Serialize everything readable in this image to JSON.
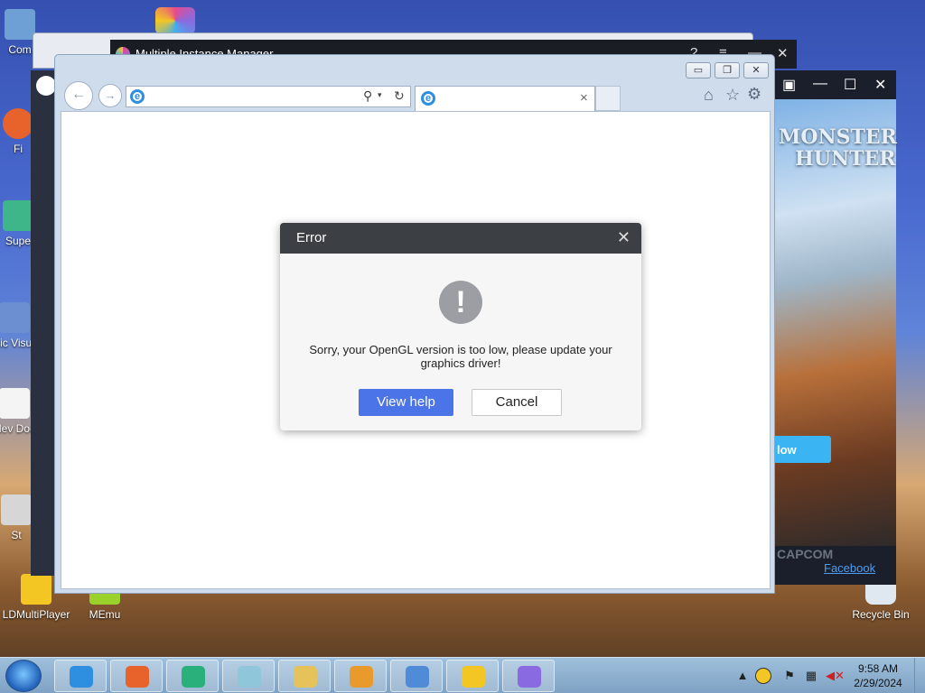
{
  "desktop": {
    "icons": [
      {
        "label": "Com",
        "icon": "computer-icon"
      },
      {
        "label": "Fi",
        "icon": "firefox-icon"
      },
      {
        "label": "Supe",
        "icon": "app-icon"
      },
      {
        "label": "Mic Visua",
        "icon": "app-icon"
      },
      {
        "label": "Nev Doc",
        "icon": "document-icon"
      },
      {
        "label": "St",
        "icon": "app-icon"
      },
      {
        "label": "LDMultiPlayer",
        "icon": "ldmultiplayer-icon"
      },
      {
        "label": "MEmu",
        "icon": "memu-icon"
      },
      {
        "label": "Recycle Bin",
        "icon": "recycle-bin-icon"
      }
    ]
  },
  "mim_window": {
    "title": "Multiple Instance Manager",
    "help": "?",
    "menu": "≡",
    "minimize": "—",
    "close": "✕"
  },
  "game_window": {
    "minimize": "—",
    "maximize": "☐",
    "close": "✕",
    "logo_line1": "MONSTER",
    "logo_line2": "HUNTER",
    "follow_label": "low",
    "capcom": "CAPCOM",
    "facebook": "Facebook"
  },
  "browser": {
    "btn_minimize": "▭",
    "btn_restore": "❐",
    "btn_close": "✕",
    "back": "←",
    "forward": "→",
    "address_value": "",
    "search_glyph": "⚲",
    "refresh_glyph": "↻",
    "tab_title": "",
    "tab_close": "×",
    "home": "⌂",
    "favorites": "☆",
    "settings": "⚙"
  },
  "dialog": {
    "title": "Error",
    "close": "✕",
    "icon_glyph": "!",
    "message": "Sorry, your OpenGL version is too low, please update your graphics driver!",
    "primary_label": "View help",
    "secondary_label": "Cancel"
  },
  "taskbar": {
    "items": [
      {
        "name": "ie-taskbar-icon",
        "color": "#2e8fe0"
      },
      {
        "name": "firefox-taskbar-icon",
        "color": "#e8622b"
      },
      {
        "name": "edge-taskbar-icon",
        "color": "#2ab07a"
      },
      {
        "name": "notepad-taskbar-icon",
        "color": "#8fc6d9"
      },
      {
        "name": "explorer-taskbar-icon",
        "color": "#e6c35a"
      },
      {
        "name": "media-player-taskbar-icon",
        "color": "#e89a2c"
      },
      {
        "name": "control-panel-taskbar-icon",
        "color": "#4f8bd6"
      },
      {
        "name": "ldplayer-taskbar-icon",
        "color": "#f3c623"
      },
      {
        "name": "memu-taskbar-icon",
        "color": "#8a6ae0"
      }
    ],
    "time": "9:58 AM",
    "date": "2/29/2024"
  }
}
